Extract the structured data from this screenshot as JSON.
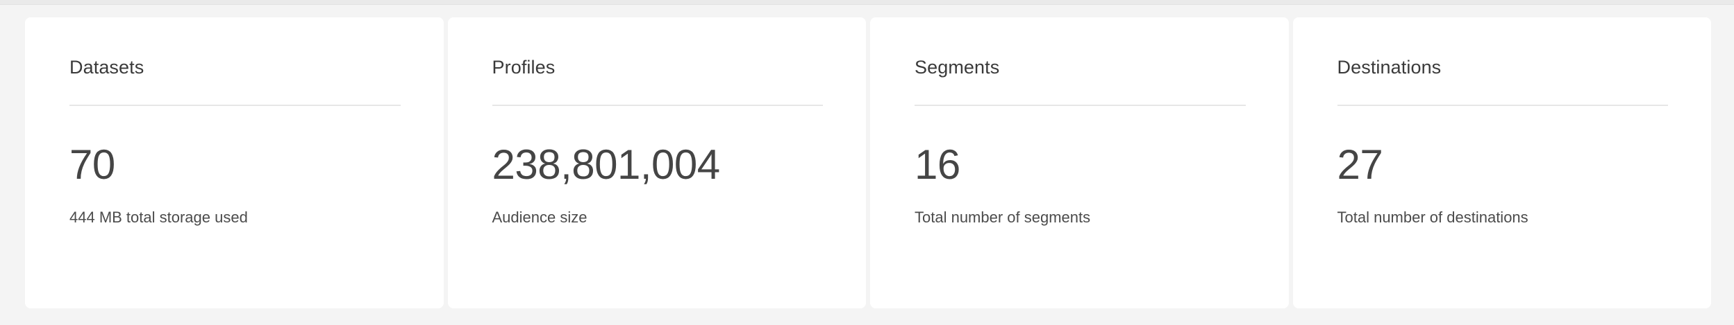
{
  "cards": [
    {
      "title": "Datasets",
      "value": "70",
      "caption": "444 MB total storage used"
    },
    {
      "title": "Profiles",
      "value": "238,801,004",
      "caption": "Audience size"
    },
    {
      "title": "Segments",
      "value": "16",
      "caption": "Total number of segments"
    },
    {
      "title": "Destinations",
      "value": "27",
      "caption": "Total number of destinations"
    }
  ]
}
